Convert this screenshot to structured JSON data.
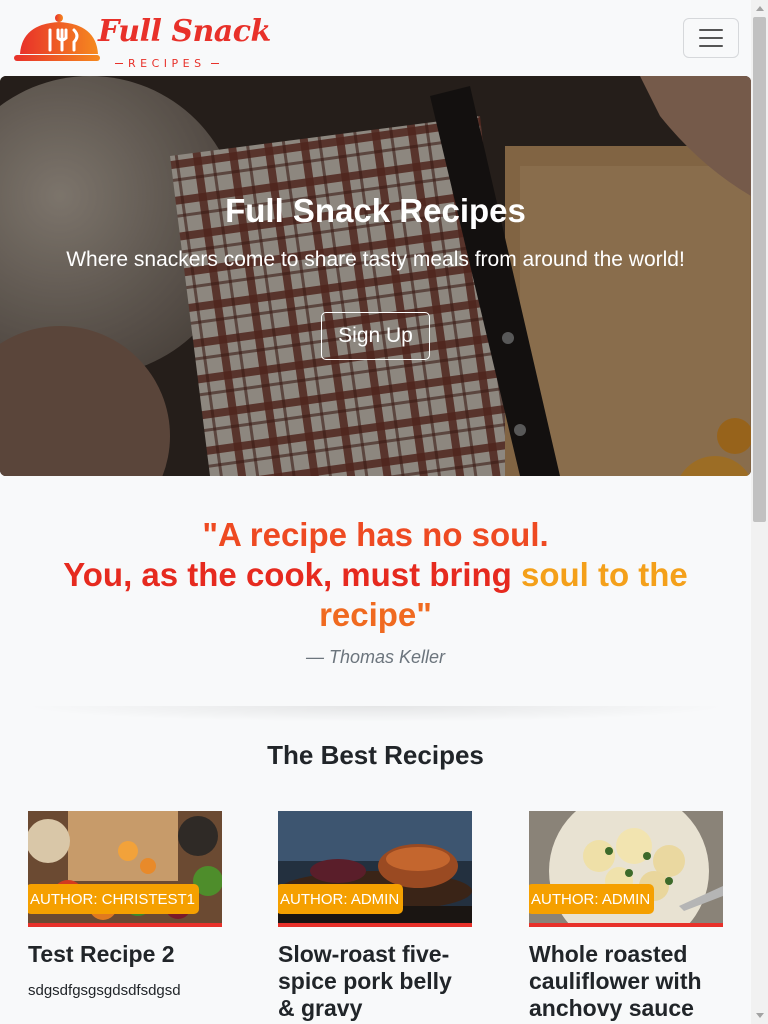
{
  "navbar": {
    "logo_main": "Full Snack",
    "logo_sub": "RECIPES",
    "logo_icon": "cloche-icon",
    "toggler_icon": "hamburger-menu-icon"
  },
  "hero": {
    "title": "Full Snack Recipes",
    "subtitle": "Where snackers come to share tasty meals from around the world!",
    "button_label": "Sign Up"
  },
  "quote": {
    "line1": "\"A recipe has no soul.",
    "line2a": "You, as the cook, must bring ",
    "line2b": "soul to the",
    "line3": "recipe\"",
    "author": "— Thomas Keller"
  },
  "recipes": {
    "section_title": "The Best Recipes",
    "cards": [
      {
        "author": "AUTHOR: CHRISTEST1",
        "title": "Test Recipe 2",
        "description": "sdgsdfgsgsgdsdfsdgsd"
      },
      {
        "author": "AUTHOR: ADMIN",
        "title": "Slow-roast five-spice pork belly & gravy",
        "description": ""
      },
      {
        "author": "AUTHOR: ADMIN",
        "title": "Whole roasted cauliflower with anchovy sauce",
        "description": ""
      }
    ]
  },
  "colors": {
    "brand_red": "#e8312a",
    "brand_orange": "#f5a000",
    "background": "#f8f9fa"
  }
}
